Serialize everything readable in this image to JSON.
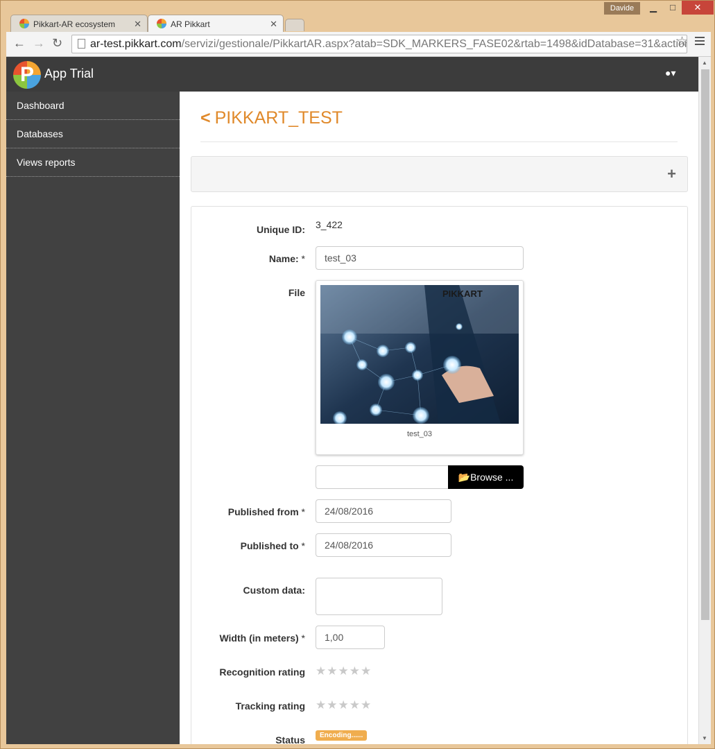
{
  "window": {
    "user": "Davide",
    "minimize": "▁",
    "maximize": "□",
    "close": "✕"
  },
  "tabs": [
    {
      "label": "Pikkart-AR ecosystem"
    },
    {
      "label": "AR Pikkart"
    }
  ],
  "address_bar": {
    "host": "ar-test.pikkart.com",
    "path": "/servizi/gestionale/PikkartAR.aspx?atab=SDK_MARKERS_FASE02&rtab=1498&idDatabase=31&action"
  },
  "app": {
    "title": "App Trial",
    "logo_letter": "P"
  },
  "sidebar": {
    "items": [
      {
        "label": "Dashboard"
      },
      {
        "label": "Databases"
      },
      {
        "label": "Views reports"
      }
    ]
  },
  "page": {
    "title": "PIKKART_TEST"
  },
  "form": {
    "unique_id_label": "Unique ID:",
    "unique_id_value": "3_422",
    "name_label": "Name:",
    "name_value": "test_03",
    "file_label": "File",
    "file_caption": "test_03",
    "image_brand": "PIKKART",
    "browse_label": "Browse ...",
    "published_from_label": "Published from",
    "published_from_value": "24/08/2016",
    "published_to_label": "Published to",
    "published_to_value": "24/08/2016",
    "custom_data_label": "Custom data:",
    "custom_data_value": "",
    "width_label": "Width (in meters)",
    "width_value": "1,00",
    "recognition_label": "Recognition rating",
    "tracking_label": "Tracking rating",
    "status_label": "Status",
    "status_value": "Encoding......",
    "required_mark": "*"
  },
  "ratings": {
    "recognition": 0,
    "tracking": 0,
    "max": 5
  },
  "colors": {
    "accent": "#e0892a",
    "header": "#3c3c3c",
    "sidebar": "#414141",
    "badge": "#f0ad4e"
  }
}
